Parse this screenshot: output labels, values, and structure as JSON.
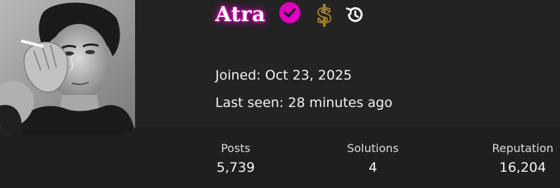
{
  "profile": {
    "username": "Atra",
    "joined": "Joined: Oct 23, 2025",
    "last_seen": "Last seen: 28 minutes ago",
    "badges": [
      "verified-check-icon",
      "dollar-sign-icon",
      "history-icon"
    ],
    "username_glow_color": "#e000c0",
    "verified_color": "#e000c0",
    "dollar_color": "#b8902a"
  },
  "stats": [
    {
      "label": "Posts",
      "value": "5,739"
    },
    {
      "label": "Solutions",
      "value": "4"
    },
    {
      "label": "Reputation",
      "value": "16,204"
    }
  ]
}
